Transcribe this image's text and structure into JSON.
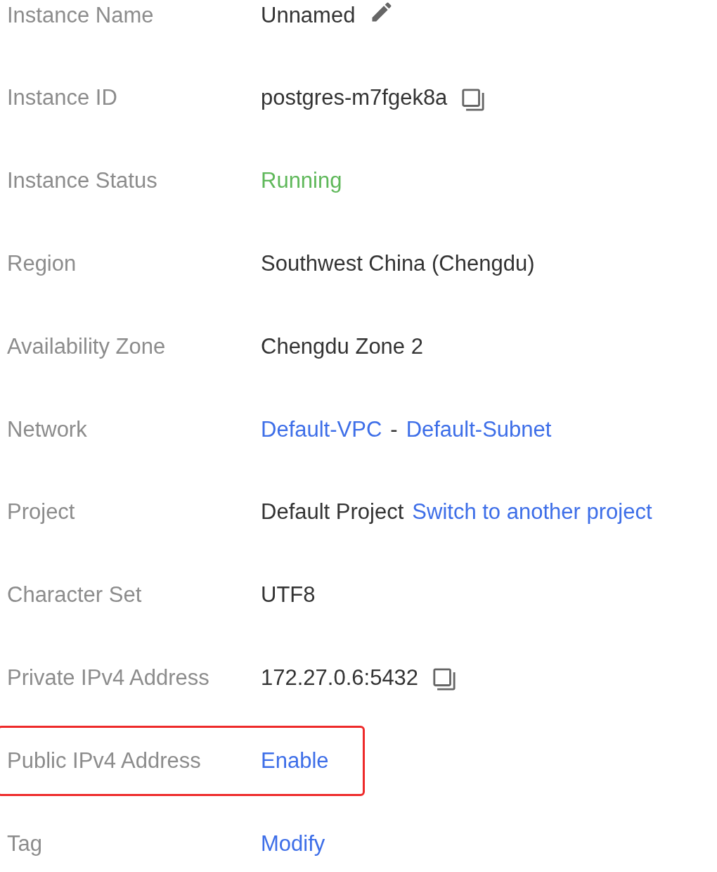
{
  "rows": [
    {
      "label": "Instance Name",
      "value": [
        {
          "kind": "text",
          "text": "Unnamed"
        },
        {
          "kind": "edit"
        }
      ],
      "highlighted": false
    },
    {
      "label": "Instance ID",
      "value": [
        {
          "kind": "text",
          "text": "postgres-m7fgek8a"
        },
        {
          "kind": "copy"
        }
      ],
      "highlighted": false
    },
    {
      "label": "Instance Status",
      "value": [
        {
          "kind": "status",
          "text": "Running"
        }
      ],
      "highlighted": false
    },
    {
      "label": "Region",
      "value": [
        {
          "kind": "text",
          "text": "Southwest China (Chengdu)"
        }
      ],
      "highlighted": false
    },
    {
      "label": "Availability Zone",
      "value": [
        {
          "kind": "text",
          "text": "Chengdu Zone 2"
        }
      ],
      "highlighted": false
    },
    {
      "label": "Network",
      "value": [
        {
          "kind": "link",
          "text": "Default-VPC"
        },
        {
          "kind": "text",
          "text": "-"
        },
        {
          "kind": "link",
          "text": "Default-Subnet"
        }
      ],
      "highlighted": false
    },
    {
      "label": "Project",
      "value": [
        {
          "kind": "text",
          "text": "Default Project"
        },
        {
          "kind": "link",
          "text": "Switch to another project"
        }
      ],
      "highlighted": false
    },
    {
      "label": "Character Set",
      "value": [
        {
          "kind": "text",
          "text": "UTF8"
        }
      ],
      "highlighted": false
    },
    {
      "label": "Private IPv4 Address",
      "value": [
        {
          "kind": "text",
          "text": "172.27.0.6:5432"
        },
        {
          "kind": "copy"
        }
      ],
      "highlighted": false
    },
    {
      "label": "Public IPv4 Address",
      "value": [
        {
          "kind": "link",
          "text": "Enable"
        }
      ],
      "highlighted": true
    },
    {
      "label": "Tag",
      "value": [
        {
          "kind": "link",
          "text": "Modify"
        }
      ],
      "highlighted": false
    }
  ]
}
